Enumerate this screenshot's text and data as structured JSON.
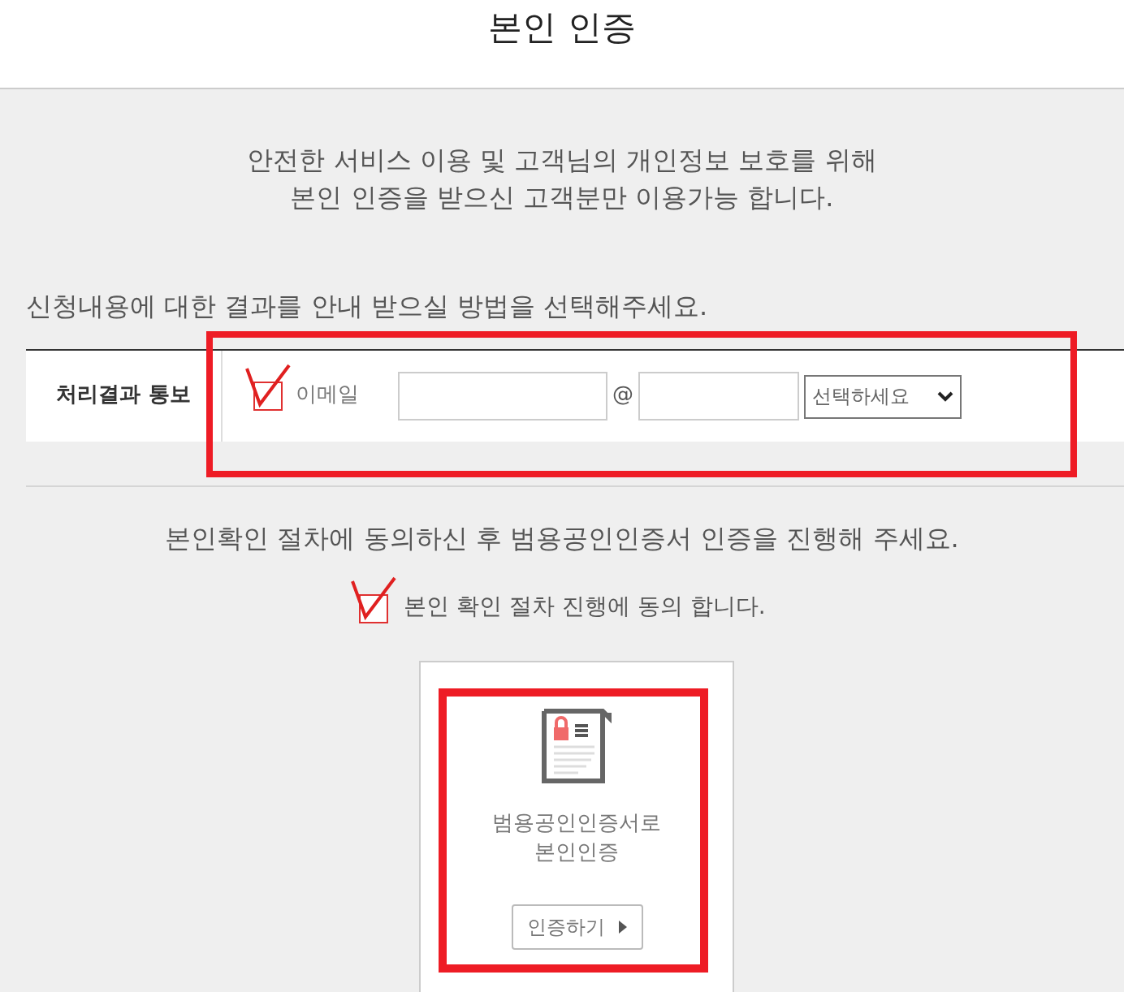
{
  "header": {
    "title": "본인 인증"
  },
  "intro": [
    "안전한 서비스 이용 및 고객님의 개인정보 보호를 위해",
    "본인 인증을 받으신 고객분만 이용가능 합니다."
  ],
  "method_prompt": "신청내용에 대한 결과를 안내 받으실 방법을 선택해주세요.",
  "notice_row": {
    "label": "처리결과 통보",
    "email_checkbox": {
      "label": "이메일",
      "checked": true
    },
    "at_sign": "@",
    "domain_select": {
      "value": "선택하세요"
    }
  },
  "consent": {
    "prompt": "본인확인 절차에 동의하신 후 범용공인인증서 인증을 진행해 주세요.",
    "checkbox": {
      "label": "본인 확인 절차 진행에 동의 합니다.",
      "checked": true
    }
  },
  "cert_card": {
    "title": [
      "범용공인인증서로",
      "본인인증"
    ],
    "button": "인증하기"
  }
}
